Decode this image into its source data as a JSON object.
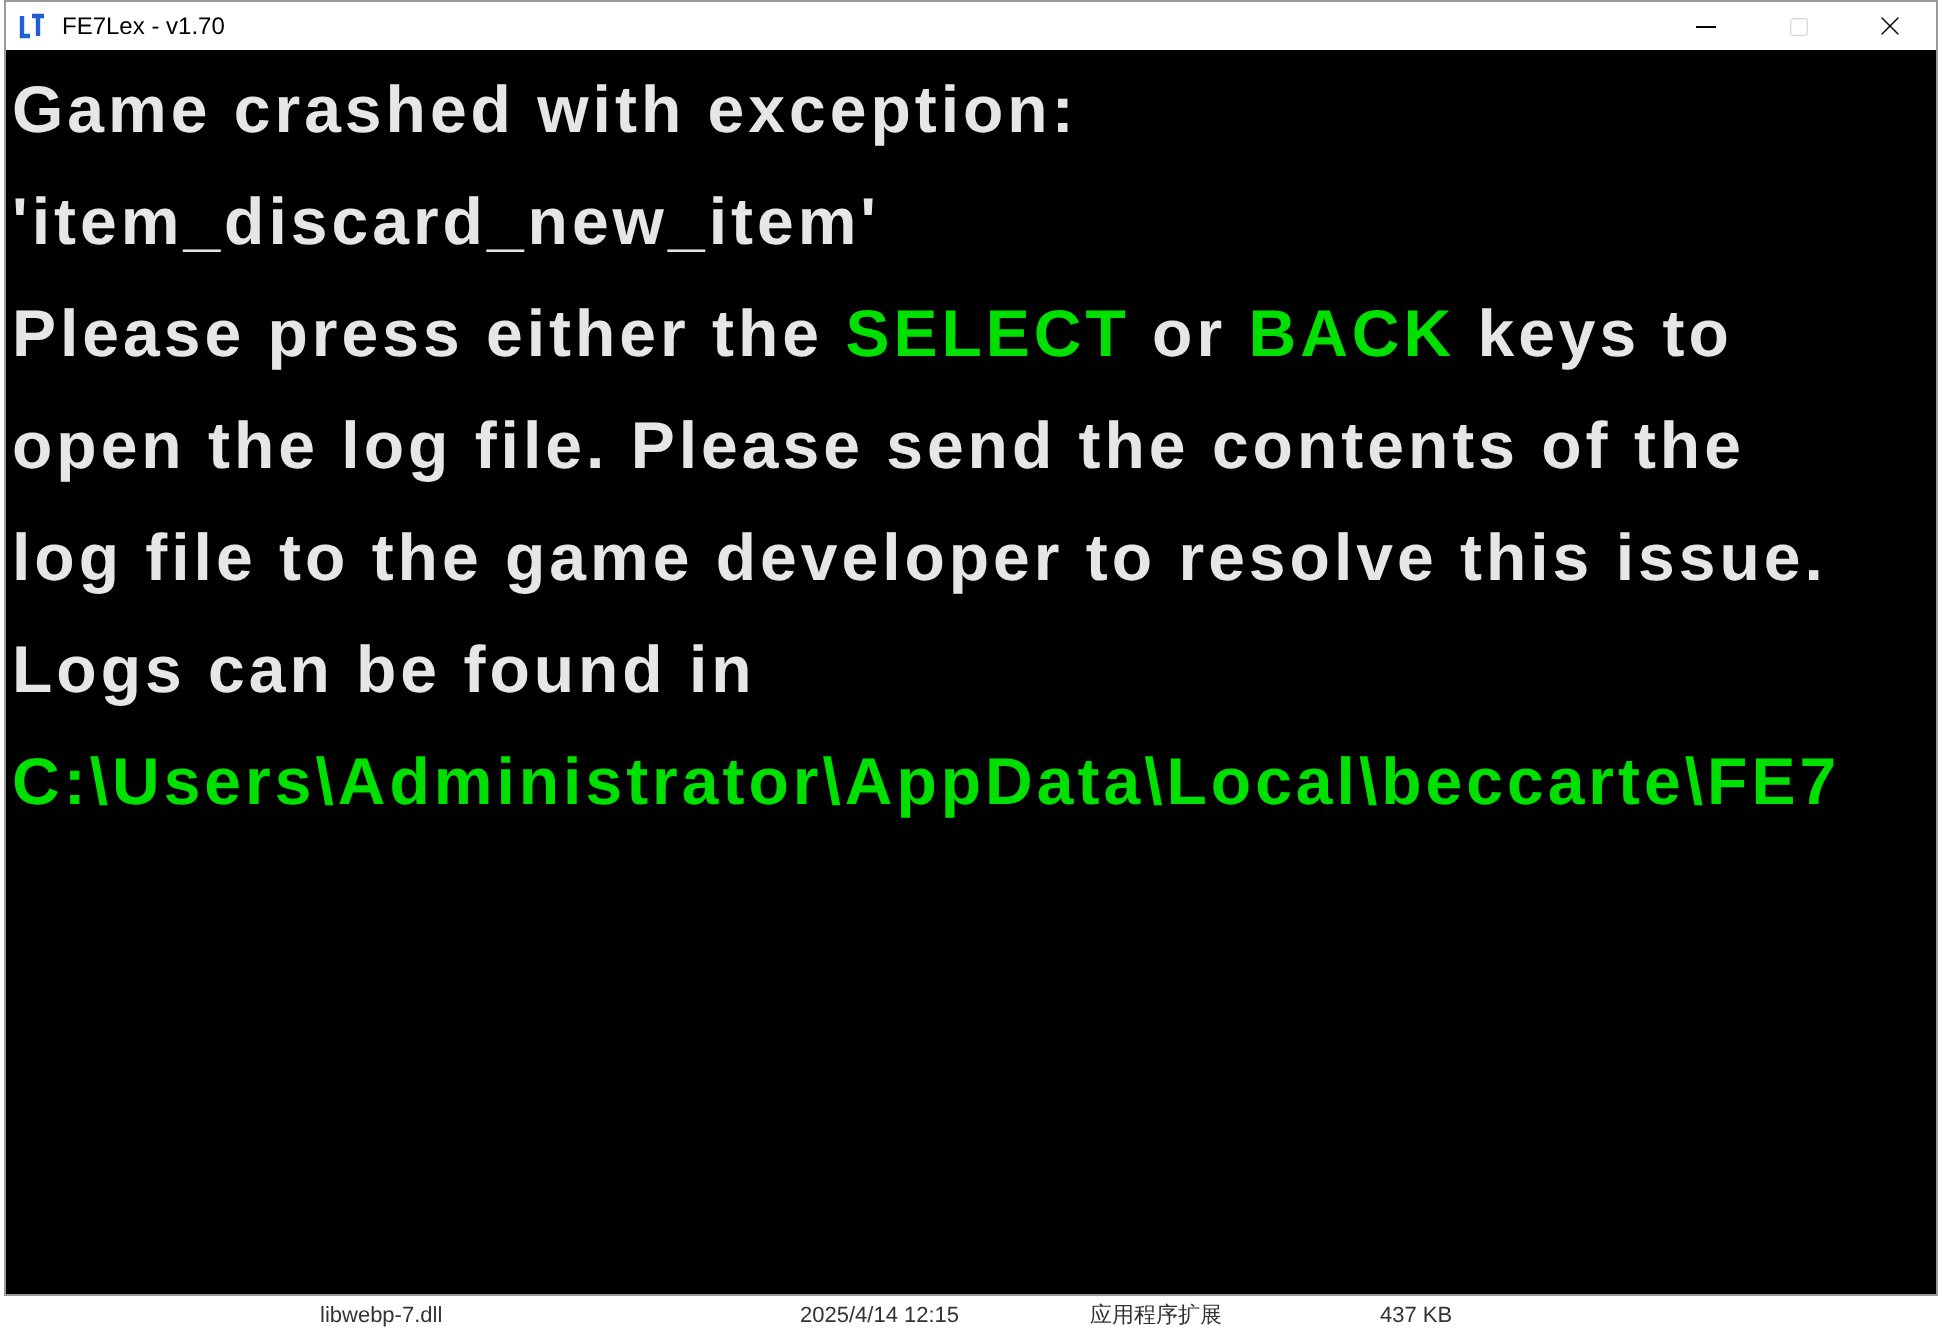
{
  "window": {
    "title": "FE7Lex - v1.70",
    "maximize_disabled": true
  },
  "message_lines": [
    [
      {
        "text": "Game crashed with exception:",
        "kind": "plain"
      }
    ],
    [
      {
        "text": "'item_discard_new_item'",
        "kind": "plain"
      }
    ],
    [
      {
        "text": "Please press either the ",
        "kind": "plain"
      },
      {
        "text": "SELECT",
        "kind": "highlight"
      },
      {
        "text": " or ",
        "kind": "plain"
      },
      {
        "text": "BACK",
        "kind": "highlight"
      },
      {
        "text": " keys to",
        "kind": "plain"
      }
    ],
    [
      {
        "text": "open the log file. Please send the contents of the",
        "kind": "plain"
      }
    ],
    [
      {
        "text": "log file to the game developer to resolve this issue.",
        "kind": "plain"
      }
    ],
    [
      {
        "text": "Logs can be found in",
        "kind": "plain"
      }
    ],
    [
      {
        "text": "C:\\Users\\Administrator\\AppData\\Local\\beccarte\\FE7",
        "kind": "highlight"
      }
    ]
  ],
  "background_file_row": {
    "name": "libwebp-7.dll",
    "date": "2025/4/14 12:15",
    "type": "应用程序扩展",
    "size": "437 KB"
  }
}
